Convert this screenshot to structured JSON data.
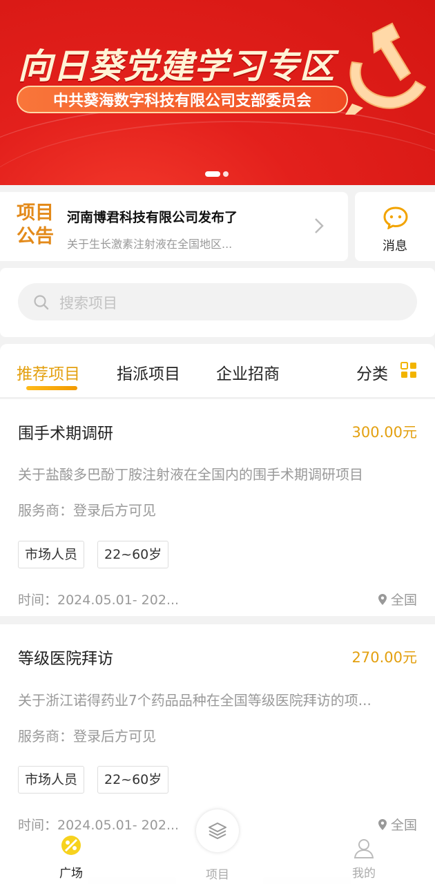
{
  "banner": {
    "title": "向日葵党建学习专区",
    "subtitle": "中共葵海数字科技有限公司支部委员会"
  },
  "notice": {
    "tag": "项目公告",
    "title": "河南博君科技有限公司发布了",
    "desc": "关于生长激素注射液在全国地区..."
  },
  "message": {
    "label": "消息"
  },
  "search": {
    "placeholder": "搜索项目"
  },
  "tabs": {
    "items": [
      "推荐项目",
      "指派项目",
      "企业招商"
    ],
    "category": "分类"
  },
  "projects": [
    {
      "title": "围手术期调研",
      "price": "300.00元",
      "desc": "关于盐酸多巴酚丁胺注射液在全国内的围手术期调研项目",
      "provider": "服务商：登录后方可见",
      "tags": [
        "市场人员",
        "22~60岁"
      ],
      "time": "时间：2024.05.01- 202...",
      "location": "全国"
    },
    {
      "title": "等级医院拜访",
      "price": "270.00元",
      "desc": "关于浙江诺得药业7个药品品种在全国等级医院拜访的项...",
      "provider": "服务商：登录后方可见",
      "tags": [
        "市场人员",
        "22~60岁"
      ],
      "time": "时间：2024.05.01- 202...",
      "location": "全国"
    }
  ],
  "bottom_nav": [
    "广场",
    "项目",
    "我的"
  ],
  "colors": {
    "accent": "#e3a010",
    "banner_red": "#e3201c"
  }
}
